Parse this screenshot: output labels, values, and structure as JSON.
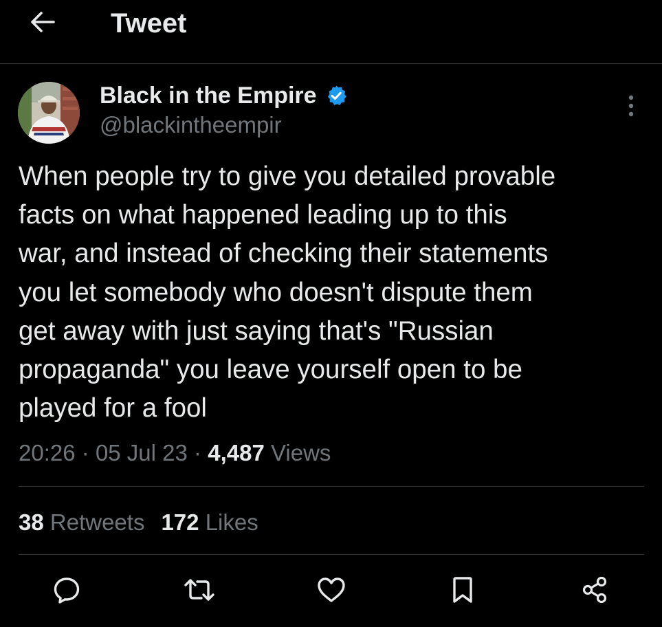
{
  "header": {
    "title": "Tweet",
    "back_icon": "arrow-left-icon"
  },
  "author": {
    "display_name": "Black in the Empire",
    "handle": "@blackintheempir",
    "verified_icon": "verified-badge-icon",
    "verified_color": "#1d9bf0"
  },
  "tweet": {
    "text": "When people try to give you detailed provable\nfacts on what happened leading up to this\nwar, and instead of checking their statements\nyou let somebody who doesn't dispute them\nget away with just saying that's \"Russian\npropaganda\" you leave yourself open to be\nplayed for a fool",
    "time": "20:26",
    "separator": "·",
    "date": "05 Jul 23",
    "views_count": "4,487",
    "views_label": "Views"
  },
  "stats": {
    "retweets_count": "38",
    "retweets_label": "Retweets",
    "likes_count": "172",
    "likes_label": "Likes"
  },
  "actions": [
    "reply-icon",
    "retweet-icon",
    "like-icon",
    "bookmark-icon",
    "share-icon"
  ],
  "colors": {
    "background": "#000000",
    "text": "#e7e9ea",
    "secondary_text": "#71767b",
    "divider": "#2f3336",
    "accent": "#1d9bf0"
  }
}
